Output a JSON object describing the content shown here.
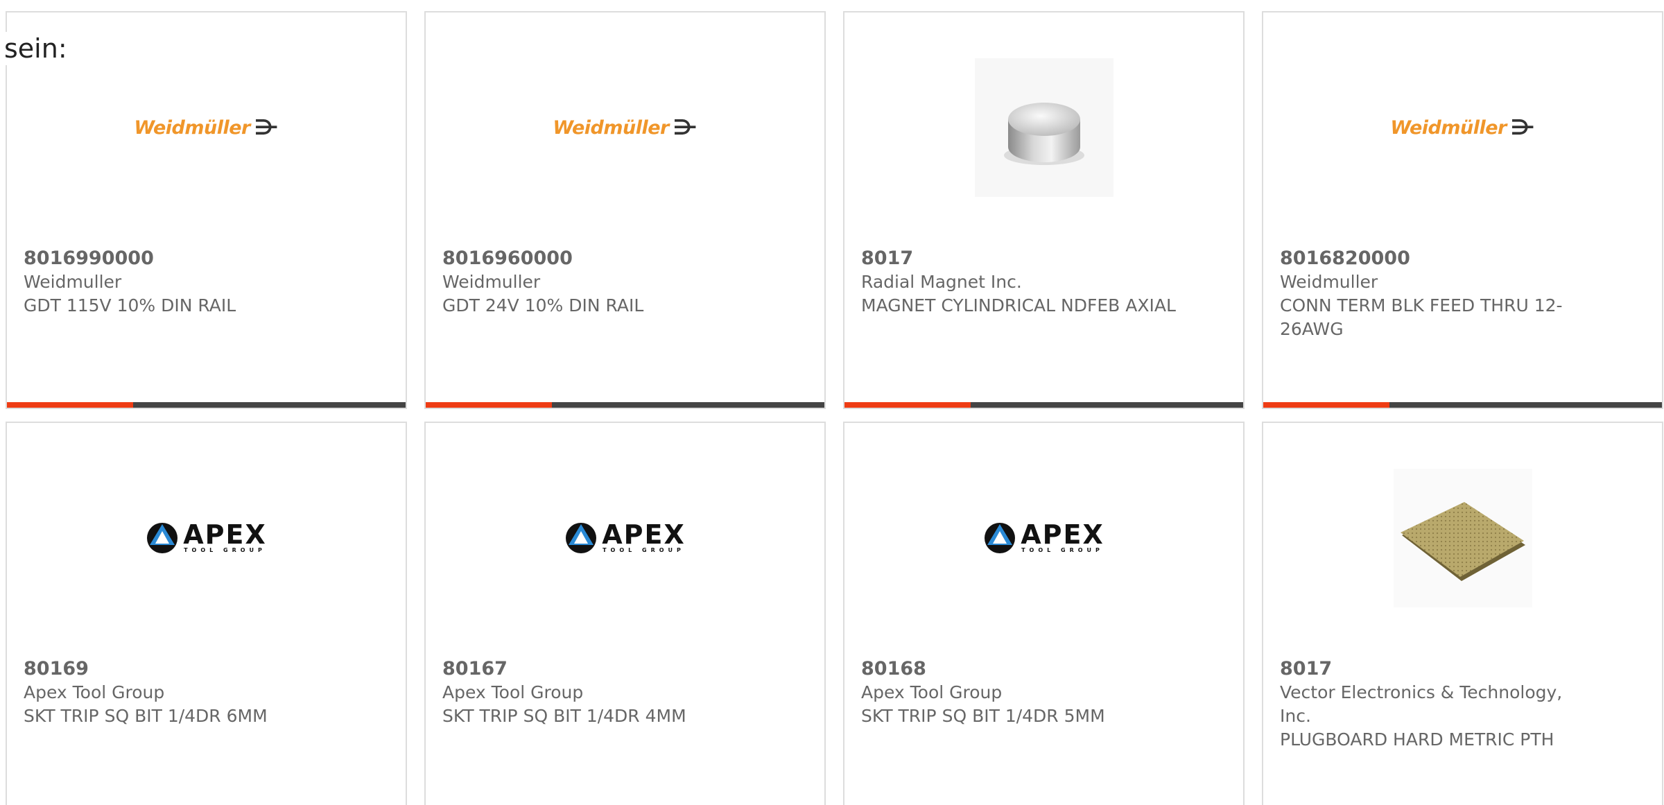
{
  "intro_text": "sein:",
  "colors": {
    "accent": "#ee3c14",
    "bar": "#444444",
    "weidmuller": "#f0962a"
  },
  "products": [
    {
      "part": "8016990000",
      "manufacturer": "Weidmuller",
      "description": "GDT 115V 10% DIN RAIL",
      "image": "weidmuller-logo",
      "logo_text": "Weidmüller"
    },
    {
      "part": "8016960000",
      "manufacturer": "Weidmuller",
      "description": "GDT 24V 10% DIN RAIL",
      "image": "weidmuller-logo",
      "logo_text": "Weidmüller"
    },
    {
      "part": "8017",
      "manufacturer": "Radial Magnet Inc.",
      "description": "MAGNET CYLINDRICAL NDFEB AXIAL",
      "image": "magnet-photo"
    },
    {
      "part": "8016820000",
      "manufacturer": "Weidmuller",
      "description": "CONN TERM BLK FEED THRU 12-26AWG",
      "image": "weidmuller-logo",
      "logo_text": "Weidmüller"
    },
    {
      "part": "80169",
      "manufacturer": "Apex Tool Group",
      "description": "SKT TRIP SQ BIT 1/4DR 6MM",
      "image": "apex-logo",
      "logo_text": "APEX",
      "logo_subtext": "TOOL GROUP"
    },
    {
      "part": "80167",
      "manufacturer": "Apex Tool Group",
      "description": "SKT TRIP SQ BIT 1/4DR 4MM",
      "image": "apex-logo",
      "logo_text": "APEX",
      "logo_subtext": "TOOL GROUP"
    },
    {
      "part": "80168",
      "manufacturer": "Apex Tool Group",
      "description": "SKT TRIP SQ BIT 1/4DR 5MM",
      "image": "apex-logo",
      "logo_text": "APEX",
      "logo_subtext": "TOOL GROUP"
    },
    {
      "part": "8017",
      "manufacturer": "Vector Electronics & Technology, Inc.",
      "description": "PLUGBOARD HARD METRIC PTH",
      "image": "plugboard-photo"
    }
  ]
}
